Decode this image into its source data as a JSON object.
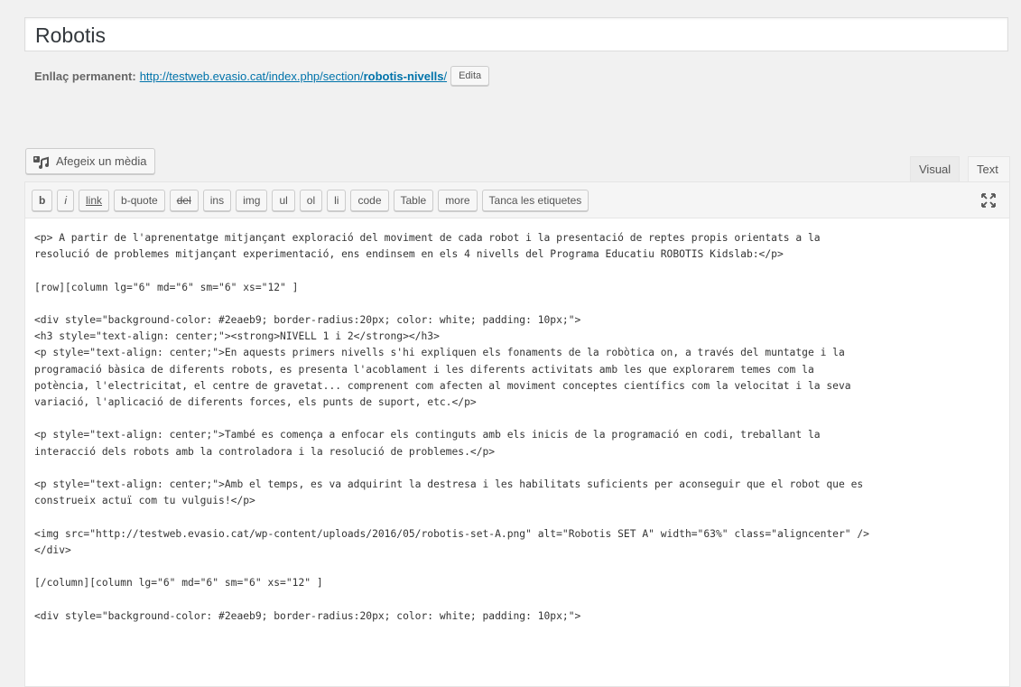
{
  "post": {
    "title": "Robotis"
  },
  "permalink": {
    "label": "Enllaç permanent:",
    "url_prefix": "http://testweb.evasio.cat/index.php/section/",
    "slug": "robotis-nivells",
    "url_suffix": "/",
    "edit_label": "Edita"
  },
  "media": {
    "add_media_label": "Afegeix un mèdia"
  },
  "editor_tabs": {
    "visual": "Visual",
    "text": "Text"
  },
  "quicktags": [
    "b",
    "i",
    "link",
    "b-quote",
    "del",
    "ins",
    "img",
    "ul",
    "ol",
    "li",
    "code",
    "Table",
    "more",
    "Tanca les etiquetes"
  ],
  "content_lines": [
    "<p> A partir de l'aprenentatge mitjançant exploració del moviment de cada robot i la presentació de reptes propis orientats a la",
    "resolució de problemes mitjançant experimentació, ens endinsem en els 4 nivells del Programa Educatiu ROBOTIS Kidslab:</p>",
    "",
    "[row][column lg=\"6\" md=\"6\" sm=\"6\" xs=\"12\" ]",
    "",
    "<div style=\"background-color: #2eaeb9; border-radius:20px; color: white; padding: 10px;\">",
    "<h3 style=\"text-align: center;\"><strong>NIVELL 1 i 2</strong></h3>",
    "<p style=\"text-align: center;\">En aquests primers nivells s'hi expliquen els fonaments de la robòtica on, a través del muntatge i la",
    "programació bàsica de diferents robots, es presenta l'acoblament i les diferents activitats amb les que explorarem temes com la",
    "potència, l'electricitat, el centre de gravetat... comprenent com afecten al moviment conceptes científics com la velocitat i la seva",
    "variació, l'aplicació de diferents forces, els punts de suport, etc.</p>",
    "",
    "<p style=\"text-align: center;\">També es comença a enfocar els continguts amb els inicis de la programació en codi, treballant la",
    "interacció dels robots amb la controladora i la resolució de problemes.</p>",
    "",
    "<p style=\"text-align: center;\">Amb el temps, es va adquirint la destresa i les habilitats suficients per aconseguir que el robot que es",
    "construeix actuï com tu vulguis!</p>",
    "",
    "<img src=\"http://testweb.evasio.cat/wp-content/uploads/2016/05/robotis-set-A.png\" alt=\"Robotis SET A\" width=\"63%\" class=\"aligncenter\" />",
    "</div>",
    "",
    "[/column][column lg=\"6\" md=\"6\" sm=\"6\" xs=\"12\" ]",
    "",
    "<div style=\"background-color: #2eaeb9; border-radius:20px; color: white; padding: 10px;\">"
  ]
}
